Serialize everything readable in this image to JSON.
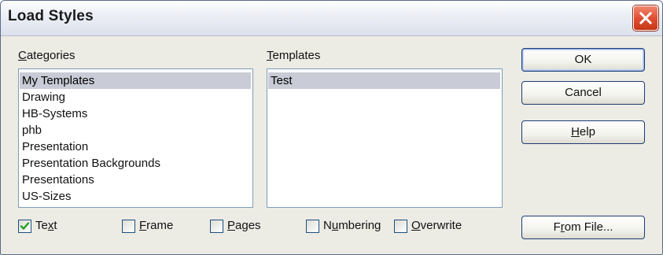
{
  "window": {
    "title": "Load Styles",
    "close_glyph": "✕"
  },
  "categories": {
    "label_underlined": "C",
    "label_rest": "ategories",
    "items": [
      {
        "label": "My Templates",
        "selected": true
      },
      {
        "label": "Drawing",
        "selected": false
      },
      {
        "label": "HB-Systems",
        "selected": false
      },
      {
        "label": "phb",
        "selected": false
      },
      {
        "label": "Presentation",
        "selected": false
      },
      {
        "label": "Presentation Backgrounds",
        "selected": false
      },
      {
        "label": "Presentations",
        "selected": false
      },
      {
        "label": "US-Sizes",
        "selected": false
      }
    ]
  },
  "templates": {
    "label_underlined": "T",
    "label_rest": "emplates",
    "items": [
      {
        "label": "Test",
        "selected": true
      }
    ]
  },
  "buttons": {
    "ok": "OK",
    "cancel": "Cancel",
    "help_underlined": "H",
    "help_rest": "elp",
    "from_file_prefix": "F",
    "from_file_underlined": "r",
    "from_file_rest": "om File..."
  },
  "options": [
    {
      "pre": "Te",
      "ul": "x",
      "post": "t",
      "checked": true
    },
    {
      "pre": "",
      "ul": "F",
      "post": "rame",
      "checked": false
    },
    {
      "pre": "",
      "ul": "P",
      "post": "ages",
      "checked": false
    },
    {
      "pre": "N",
      "ul": "u",
      "post": "mbering",
      "checked": false
    },
    {
      "pre": "",
      "ul": "O",
      "post": "verwrite",
      "checked": false
    }
  ],
  "colors": {
    "selection": "#c9ccd6",
    "close_button": "#e14f33",
    "checkmark": "#21a121"
  }
}
